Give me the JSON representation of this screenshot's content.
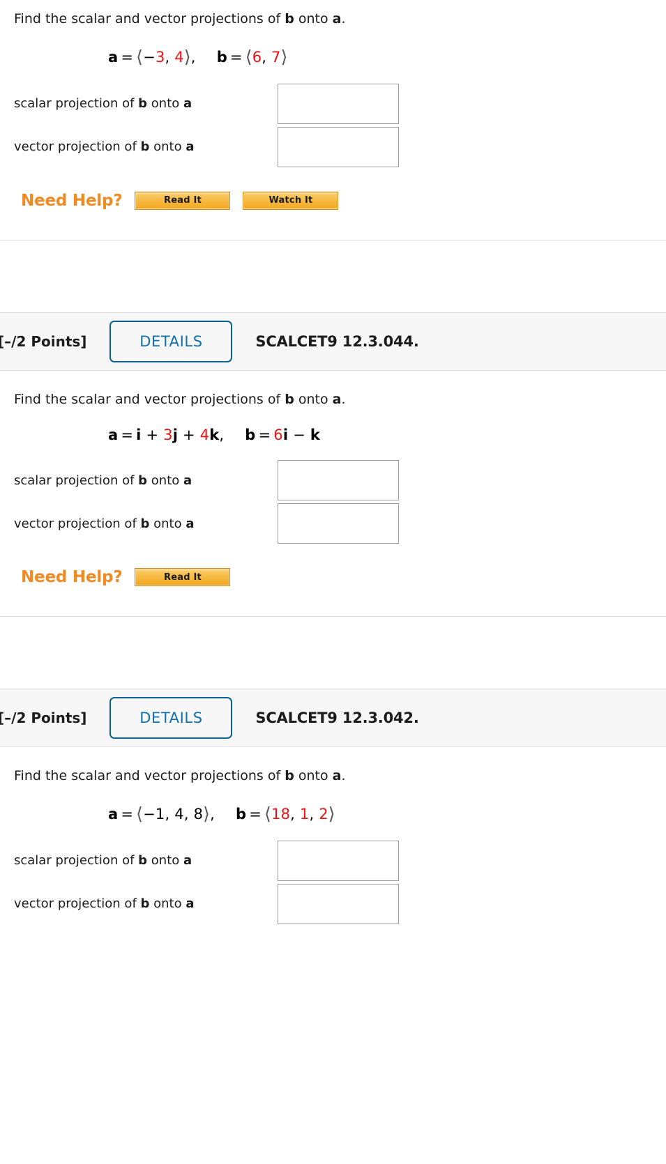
{
  "problems": [
    {
      "id": "p1",
      "has_header": false,
      "prompt_pre": "Find the scalar and vector projections of ",
      "prompt_b": "b",
      "prompt_mid": " onto ",
      "prompt_a": "a",
      "prompt_end": ".",
      "formula": {
        "a_label": "a",
        "a_eq": "=",
        "a_open": "⟨",
        "a_parts": [
          {
            "t": "−",
            "c": "black"
          },
          {
            "t": "3",
            "c": "red"
          },
          {
            "t": ", ",
            "c": "black"
          },
          {
            "t": "4",
            "c": "red"
          }
        ],
        "a_close": "⟩",
        "a_comma": ",",
        "b_label": "b",
        "b_eq": "=",
        "b_open": "⟨",
        "b_parts": [
          {
            "t": "6",
            "c": "red"
          },
          {
            "t": ", ",
            "c": "black"
          },
          {
            "t": "7",
            "c": "red"
          }
        ],
        "b_close": "⟩",
        "b_comma": ""
      },
      "answers": [
        {
          "label_pre": "scalar projection of ",
          "label_b": "b",
          "label_mid": " onto ",
          "label_a": "a",
          "value": "",
          "placeholder": ""
        },
        {
          "label_pre": "vector projection of ",
          "label_b": "b",
          "label_mid": " onto ",
          "label_a": "a",
          "value": "",
          "placeholder": ""
        }
      ],
      "need_help_label": "Need Help?",
      "help_buttons": [
        "Read It",
        "Watch It"
      ]
    },
    {
      "id": "p2",
      "has_header": true,
      "header": {
        "points": "[–/2 Points]",
        "details_label": "DETAILS",
        "reference": "SCALCET9 12.3.044."
      },
      "prompt_pre": "Find the scalar and vector projections of ",
      "prompt_b": "b",
      "prompt_mid": " onto ",
      "prompt_a": "a",
      "prompt_end": ".",
      "formula_ijk": {
        "a_label": "a",
        "a_eq": "=",
        "a_parts": [
          {
            "t": "i",
            "c": "black",
            "bold": true
          },
          {
            "t": " + ",
            "c": "black",
            "bold": false
          },
          {
            "t": "3",
            "c": "red",
            "bold": false
          },
          {
            "t": "j",
            "c": "black",
            "bold": true
          },
          {
            "t": " + ",
            "c": "black",
            "bold": false
          },
          {
            "t": "4",
            "c": "red",
            "bold": false
          },
          {
            "t": "k",
            "c": "black",
            "bold": true
          }
        ],
        "a_comma": ",",
        "b_label": "b",
        "b_eq": "=",
        "b_parts": [
          {
            "t": "6",
            "c": "red",
            "bold": false
          },
          {
            "t": "i",
            "c": "black",
            "bold": true
          },
          {
            "t": " − ",
            "c": "black",
            "bold": false
          },
          {
            "t": "k",
            "c": "black",
            "bold": true
          }
        ]
      },
      "answers": [
        {
          "label_pre": "scalar projection of ",
          "label_b": "b",
          "label_mid": " onto ",
          "label_a": "a",
          "value": "",
          "placeholder": ""
        },
        {
          "label_pre": "vector projection of ",
          "label_b": "b",
          "label_mid": " onto ",
          "label_a": "a",
          "value": "",
          "placeholder": ""
        }
      ],
      "need_help_label": "Need Help?",
      "help_buttons": [
        "Read It"
      ]
    },
    {
      "id": "p3",
      "has_header": true,
      "header": {
        "points": "[–/2 Points]",
        "details_label": "DETAILS",
        "reference": "SCALCET9 12.3.042."
      },
      "prompt_pre": "Find the scalar and vector projections of ",
      "prompt_b": "b",
      "prompt_mid": " onto ",
      "prompt_a": "a",
      "prompt_end": ".",
      "formula": {
        "a_label": "a",
        "a_eq": "=",
        "a_open": "⟨",
        "a_parts": [
          {
            "t": "−1",
            "c": "black"
          },
          {
            "t": ", ",
            "c": "black"
          },
          {
            "t": "4",
            "c": "black"
          },
          {
            "t": ", ",
            "c": "black"
          },
          {
            "t": "8",
            "c": "black"
          }
        ],
        "a_close": "⟩",
        "a_comma": ",",
        "b_label": "b",
        "b_eq": "=",
        "b_open": "⟨",
        "b_parts": [
          {
            "t": "18",
            "c": "red"
          },
          {
            "t": ", ",
            "c": "black"
          },
          {
            "t": "1",
            "c": "red"
          },
          {
            "t": ", ",
            "c": "black"
          },
          {
            "t": "2",
            "c": "red"
          }
        ],
        "b_close": "⟩",
        "b_comma": ""
      },
      "answers": [
        {
          "label_pre": "scalar projection of ",
          "label_b": "b",
          "label_mid": " onto ",
          "label_a": "a",
          "value": "",
          "placeholder": ""
        },
        {
          "label_pre": "vector projection of ",
          "label_b": "b",
          "label_mid": " onto ",
          "label_a": "a",
          "value": "",
          "placeholder": ""
        }
      ],
      "need_help_label": "",
      "help_buttons": []
    }
  ],
  "colors": {
    "red": "#ee1111",
    "black": "#000000",
    "orange": "#ef8b22",
    "details_blue": "#1071ad",
    "header_bg": "#f7f7f7"
  }
}
